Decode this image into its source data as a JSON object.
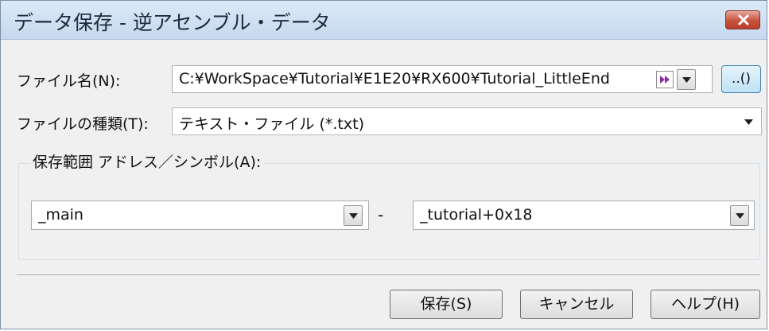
{
  "window": {
    "title": "データ保存 - 逆アセンブル・データ",
    "close_icon": "close-icon"
  },
  "file_name": {
    "label": "ファイル名(N):",
    "value": "C:¥WorkSpace¥Tutorial¥E1E20¥RX600¥Tutorial_LittleEnd",
    "browse_label": "..()"
  },
  "file_type": {
    "label": "ファイルの種類(T):",
    "value": "テキスト・ファイル (*.txt)"
  },
  "save_range": {
    "legend": "保存範囲 アドレス／シンボル(A):",
    "start_value": "_main",
    "separator": "-",
    "end_value": "_tutorial+0x18"
  },
  "buttons": {
    "save": "保存(S)",
    "cancel": "キャンセル",
    "help": "ヘルプ(H)"
  },
  "colors": {
    "titlebar": "#c5d9ef",
    "close_button": "#c9523d",
    "dialog_bg": "#f0f0f0"
  }
}
